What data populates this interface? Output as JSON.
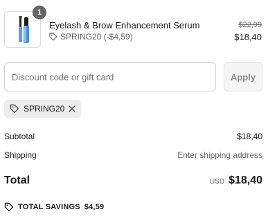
{
  "cart": {
    "item": {
      "title": "Eyelash & Brow Enhancement Serum",
      "quantity": "1",
      "discount_text": "SPRING20 (-$4,59)",
      "original_price": "$22,99",
      "price": "$18,40",
      "thumbnail_icon": "serum-bottle-image"
    }
  },
  "discount": {
    "placeholder": "Discount code or gift card",
    "apply_label": "Apply",
    "applied_code": "SPRING20"
  },
  "summary": {
    "subtotal_label": "Subtotal",
    "subtotal_value": "$18,40",
    "shipping_label": "Shipping",
    "shipping_value": "Enter shipping address",
    "total_label": "Total",
    "currency": "USD",
    "total_value": "$18,40",
    "savings_label": "TOTAL SAVINGS",
    "savings_value": "$4,59"
  },
  "colors": {
    "badge": "#666666",
    "chip_bg": "#ececec",
    "muted_text": "#666666"
  }
}
